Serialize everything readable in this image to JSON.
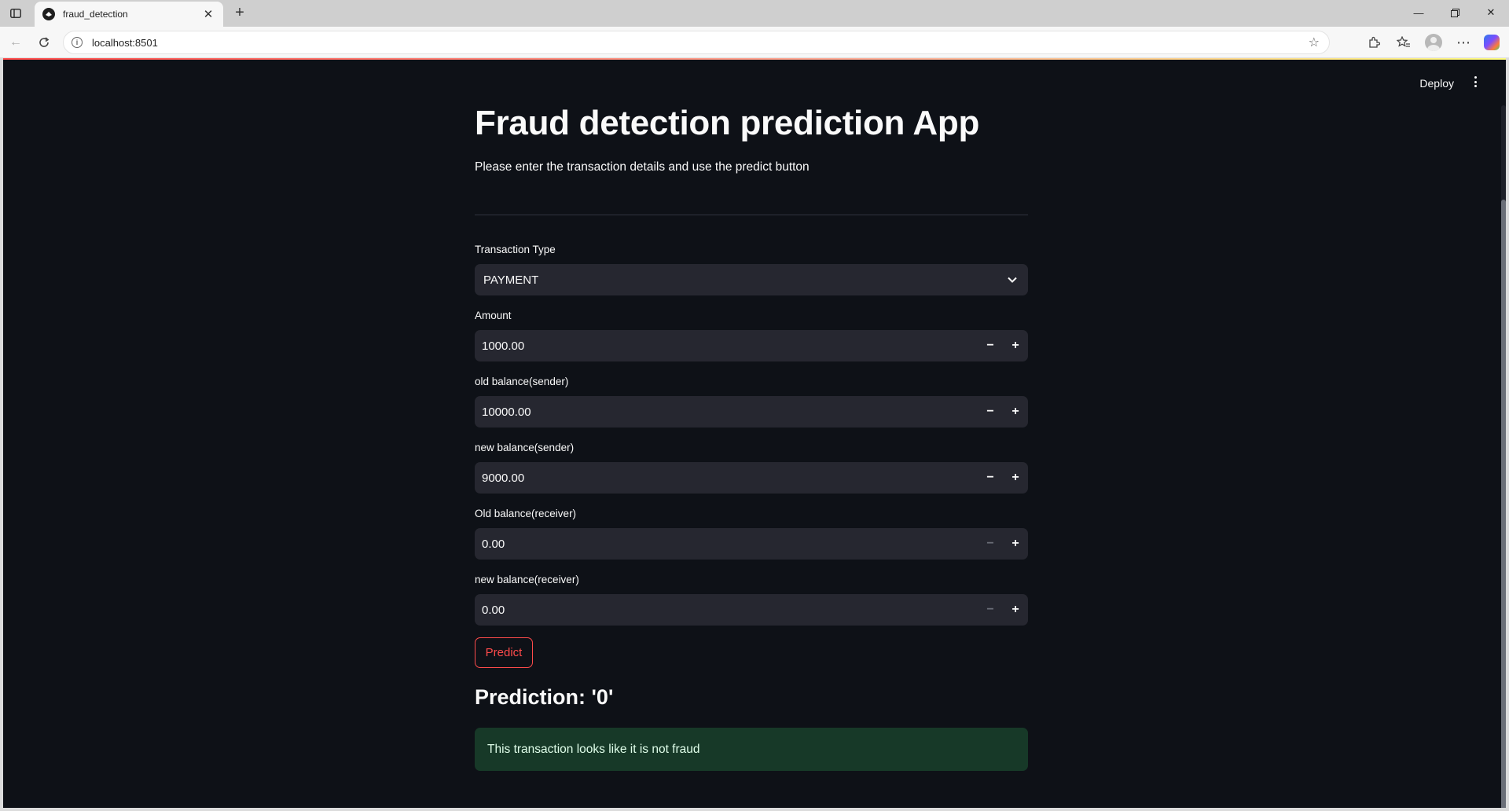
{
  "browser": {
    "tab_title": "fraud_detection",
    "url": "localhost:8501"
  },
  "header": {
    "deploy_label": "Deploy"
  },
  "app": {
    "title": "Fraud detection prediction App",
    "subtitle": "Please enter the transaction details and use the predict button"
  },
  "form": {
    "transaction_type": {
      "label": "Transaction Type",
      "value": "PAYMENT"
    },
    "amount": {
      "label": "Amount",
      "value": "1000.00"
    },
    "old_balance_sender": {
      "label": "old balance(sender)",
      "value": "10000.00"
    },
    "new_balance_sender": {
      "label": "new balance(sender)",
      "value": "9000.00"
    },
    "old_balance_receiver": {
      "label": "Old balance(receiver)",
      "value": "0.00"
    },
    "new_balance_receiver": {
      "label": "new balance(receiver)",
      "value": "0.00"
    },
    "predict_label": "Predict"
  },
  "result": {
    "prediction": "Prediction: '0'",
    "message": "This transaction looks like it is not fraud"
  },
  "colors": {
    "background": "#0e1117",
    "input_bg": "#262730",
    "accent": "#ff4b4b",
    "success_bg": "#173928"
  }
}
